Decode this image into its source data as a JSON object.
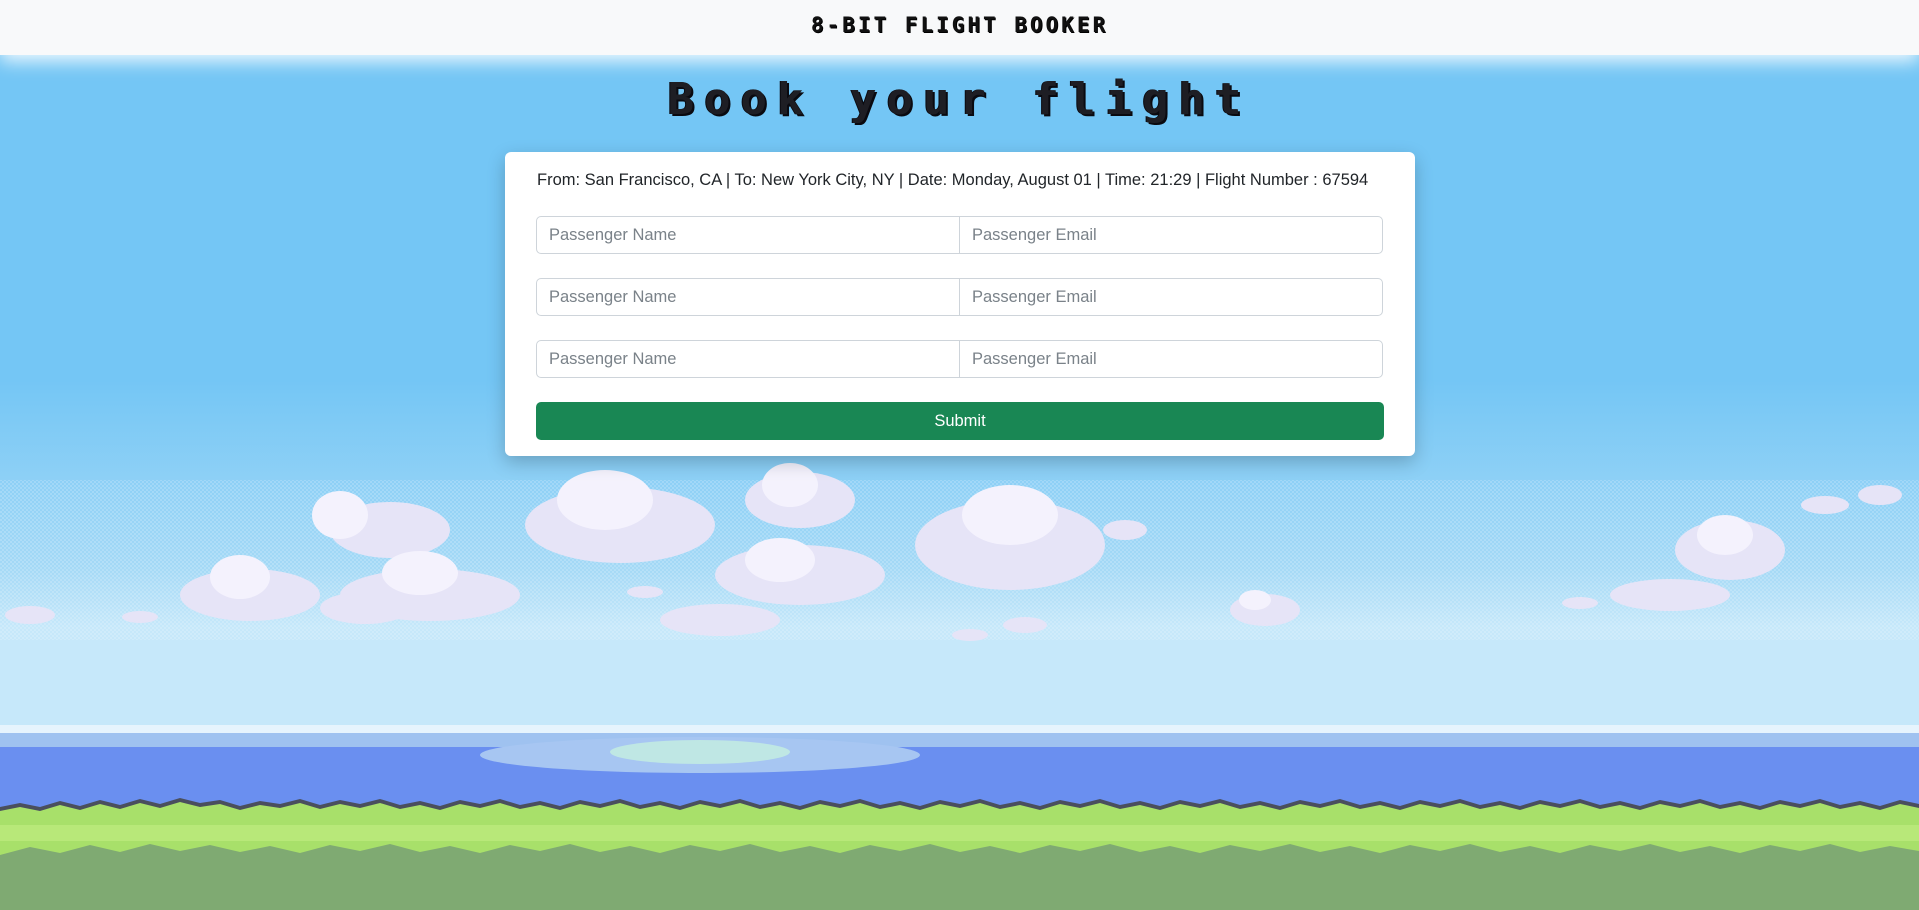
{
  "header": {
    "brand": "8-BIT FLIGHT BOOKER"
  },
  "main": {
    "title": "Book your flight"
  },
  "flight": {
    "info": "From: San Francisco, CA | To: New York City, NY | Date: Monday, August 01 | Time: 21:29 | Flight Number : 67594"
  },
  "form": {
    "name_placeholder": "Passenger Name",
    "email_placeholder": "Passenger Email",
    "submit_label": "Submit"
  },
  "colors": {
    "sky": "#74c6f5",
    "sea": "#6a8ff0",
    "grass": "#a8e06a",
    "ground": "#7faa72",
    "submit": "#198754"
  }
}
